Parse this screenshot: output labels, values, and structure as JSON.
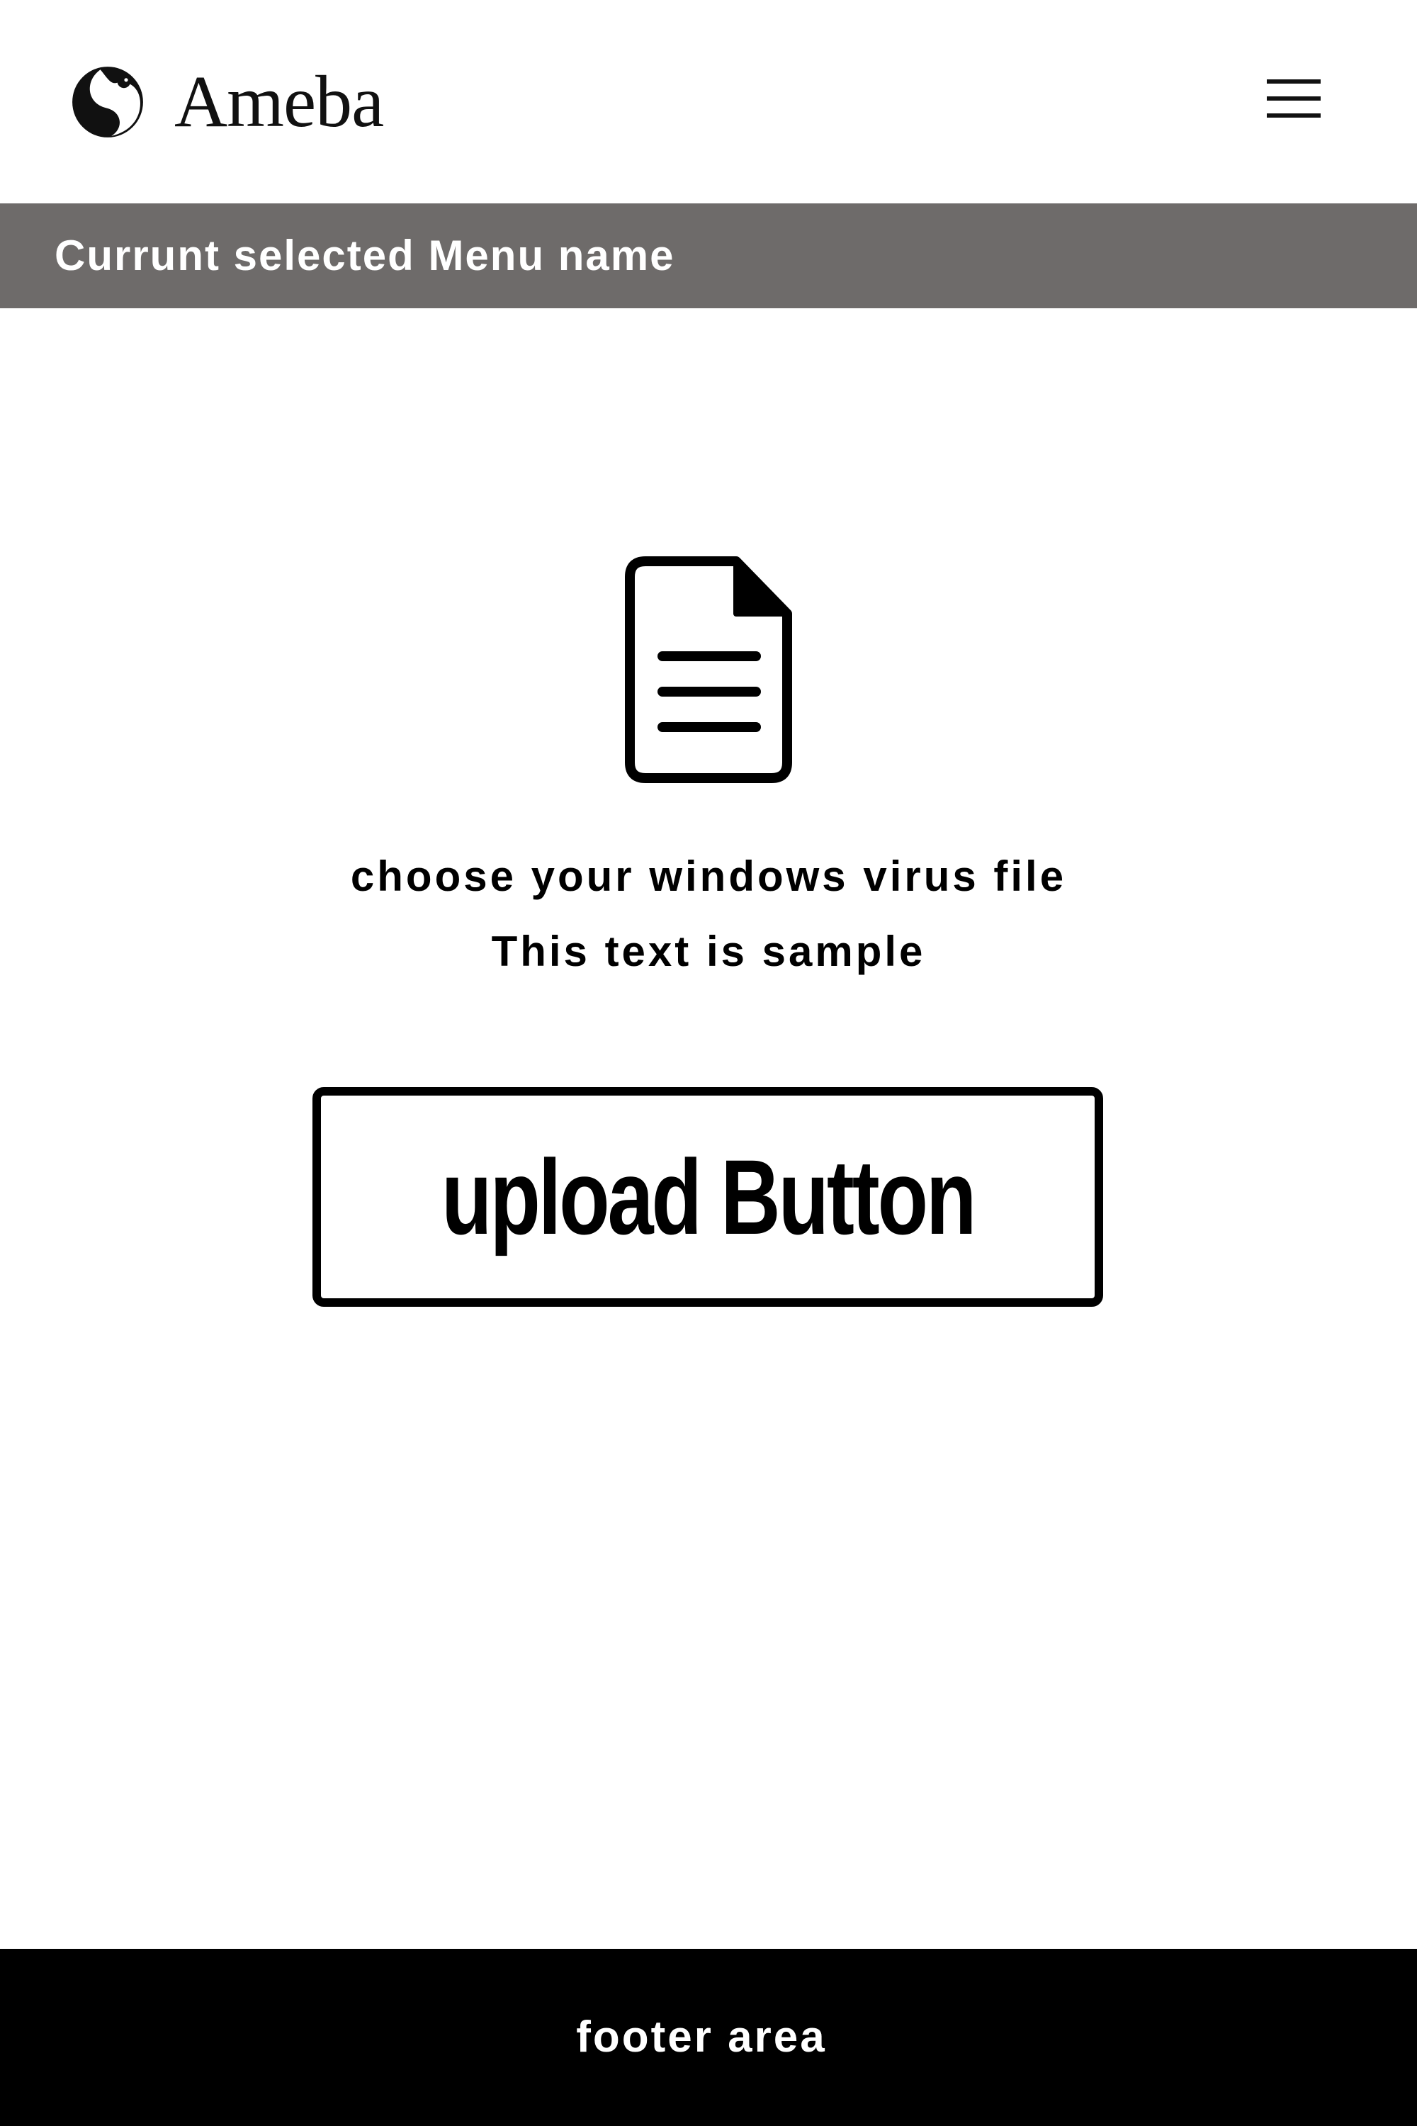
{
  "header": {
    "logo_text": "Ameba",
    "logo_icon": "ameba-logo-icon",
    "menu_icon": "hamburger-menu-icon"
  },
  "menu_bar": {
    "title": "Currunt selected Menu name",
    "background_color": "#6e6b6a"
  },
  "main": {
    "file_icon": "document-icon",
    "prompt": "choose your windows virus file",
    "sample_text": "This text is sample",
    "upload_button_label": "upload Button"
  },
  "footer": {
    "text": "footer area",
    "background_color": "#000000"
  }
}
